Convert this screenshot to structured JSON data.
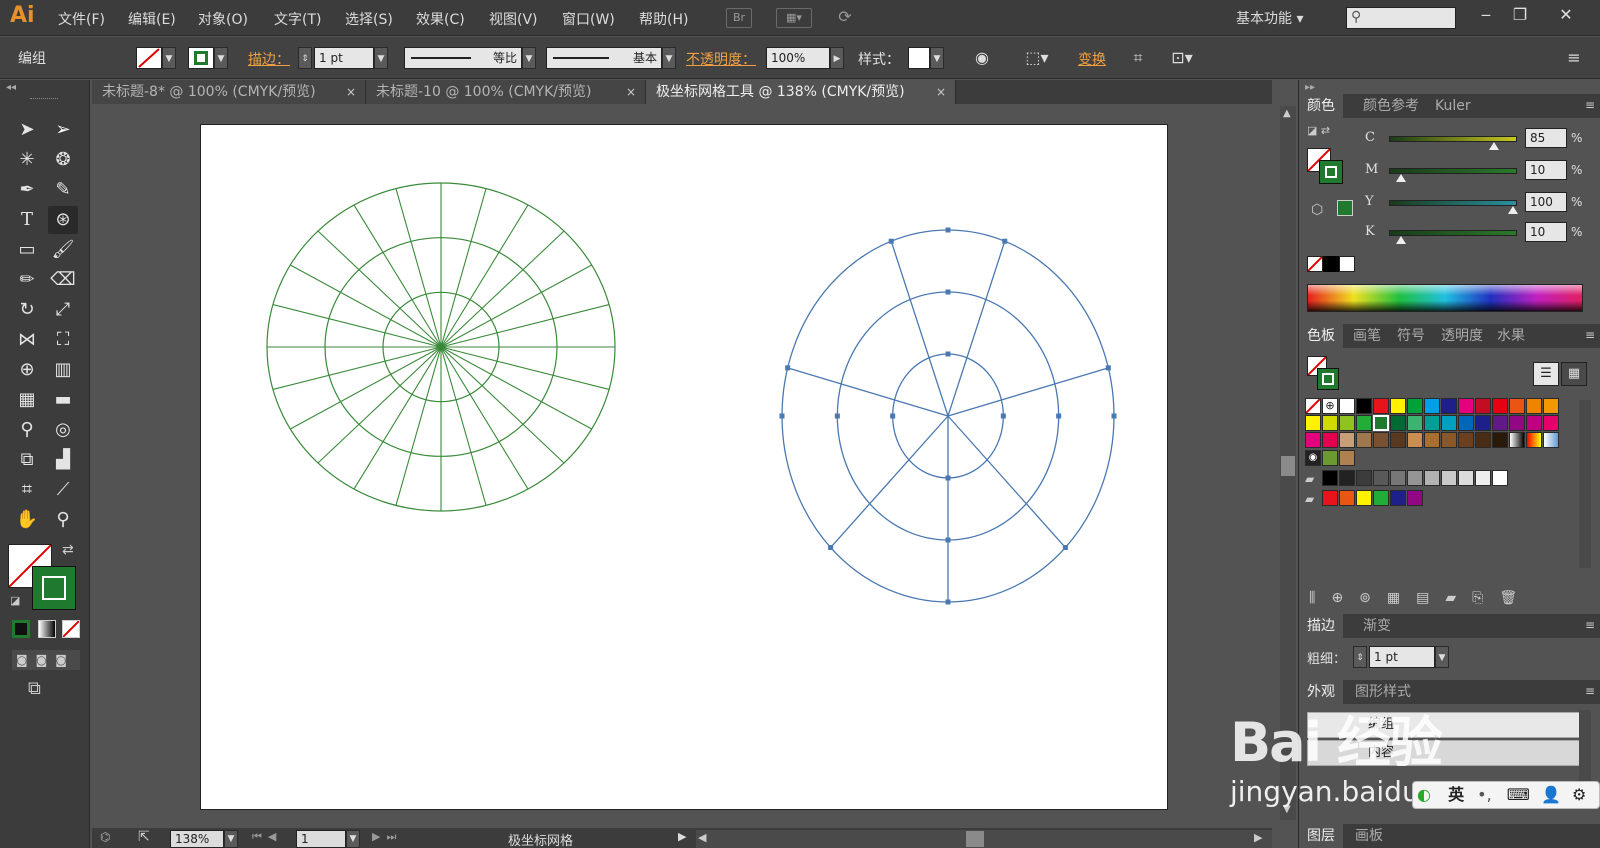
{
  "app": {
    "logo": "Ai",
    "menus": [
      "文件(F)",
      "编辑(E)",
      "对象(O)",
      "文字(T)",
      "选择(S)",
      "效果(C)",
      "视图(V)",
      "窗口(W)",
      "帮助(H)"
    ],
    "bridge_label": "Br",
    "workspace": "基本功能",
    "window_buttons": [
      "‒",
      "❐",
      "✕"
    ]
  },
  "control": {
    "selection_type": "编组",
    "stroke_link": "描边：",
    "stroke_weight": "1 pt",
    "stroke_profile": "等比",
    "brush": "基本",
    "opacity_link": "不透明度：",
    "opacity": "100%",
    "style_label": "样式：",
    "transform_link": "变换"
  },
  "tabs": [
    {
      "label": "未标题-8* @ 100% (CMYK/预览)",
      "close": "×"
    },
    {
      "label": "未标题-10 @ 100% (CMYK/预览)",
      "close": "×"
    },
    {
      "label": "极坐标网格工具 @ 138% (CMYK/预览)",
      "close": "×"
    }
  ],
  "status": {
    "zoom": "138%",
    "page": "1",
    "tool_name": "极坐标网格"
  },
  "color_panel": {
    "tabs": [
      "颜色",
      "颜色参考",
      "Kuler"
    ],
    "channels": [
      {
        "label": "C",
        "value": "85",
        "fraction": 0.85,
        "color": "#c8c81e"
      },
      {
        "label": "M",
        "value": "10",
        "fraction": 0.1,
        "color": "#2a7a2a"
      },
      {
        "label": "Y",
        "value": "100",
        "fraction": 1.0,
        "color": "#2a90a0"
      },
      {
        "label": "K",
        "value": "10",
        "fraction": 0.1,
        "color": "#2a7a2a"
      }
    ],
    "pct": "%"
  },
  "swatch_panel": {
    "tabs": [
      "色板",
      "画笔",
      "符号",
      "透明度",
      "水果"
    ]
  },
  "stroke_panel": {
    "tabs": [
      "描边",
      "渐变"
    ],
    "weight_label": "粗细：",
    "weight_value": "1 pt"
  },
  "appearance_panel": {
    "tabs": [
      "外观",
      "图形样式"
    ],
    "rows": [
      "编组",
      "内容"
    ]
  },
  "layers_panel": {
    "tabs": [
      "图层",
      "画板"
    ]
  },
  "colors": {
    "fill_stroke_green": "#1f7a2e",
    "grid_green": "#3a8a3a",
    "grid_blue": "#4a78b0"
  },
  "watermark": {
    "brand": "Bai 经验",
    "url": "jingyan.baidu.com",
    "ime_char": "英"
  }
}
